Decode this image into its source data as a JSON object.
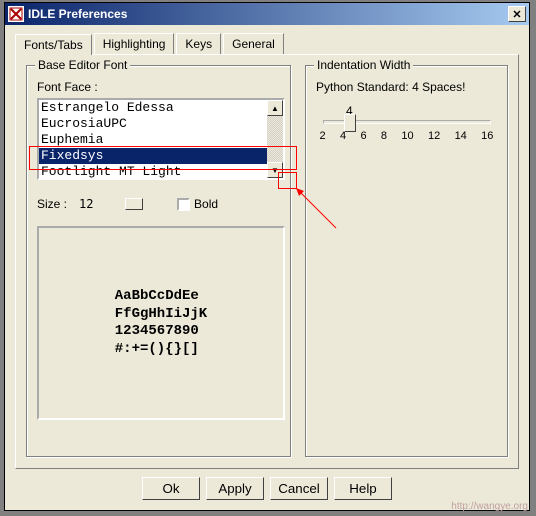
{
  "window": {
    "title": "IDLE Preferences"
  },
  "tabs": [
    {
      "label": "Fonts/Tabs"
    },
    {
      "label": "Highlighting"
    },
    {
      "label": "Keys"
    },
    {
      "label": "General"
    }
  ],
  "font_group": {
    "legend": "Base Editor Font",
    "font_face_label": "Font Face :",
    "items": [
      "Estrangelo Edessa",
      "EucrosiaUPC",
      "Euphemia",
      "Fixedsys",
      "Footlight MT Light"
    ],
    "selected_index": 3,
    "size_label": "Size :",
    "size_value": "12",
    "bold_label": "Bold",
    "preview": "AaBbCcDdEe\nFfGgHhIiJjK\n1234567890\n#:+=(){}[]"
  },
  "indent_group": {
    "legend": "Indentation Width",
    "standard_label": "Python Standard: 4 Spaces!",
    "value_label": "4",
    "ticks": [
      "2",
      "4",
      "6",
      "8",
      "10",
      "12",
      "14",
      "16"
    ]
  },
  "buttons": {
    "ok": "Ok",
    "apply": "Apply",
    "cancel": "Cancel",
    "help": "Help"
  },
  "watermark": "http://wangye.org"
}
